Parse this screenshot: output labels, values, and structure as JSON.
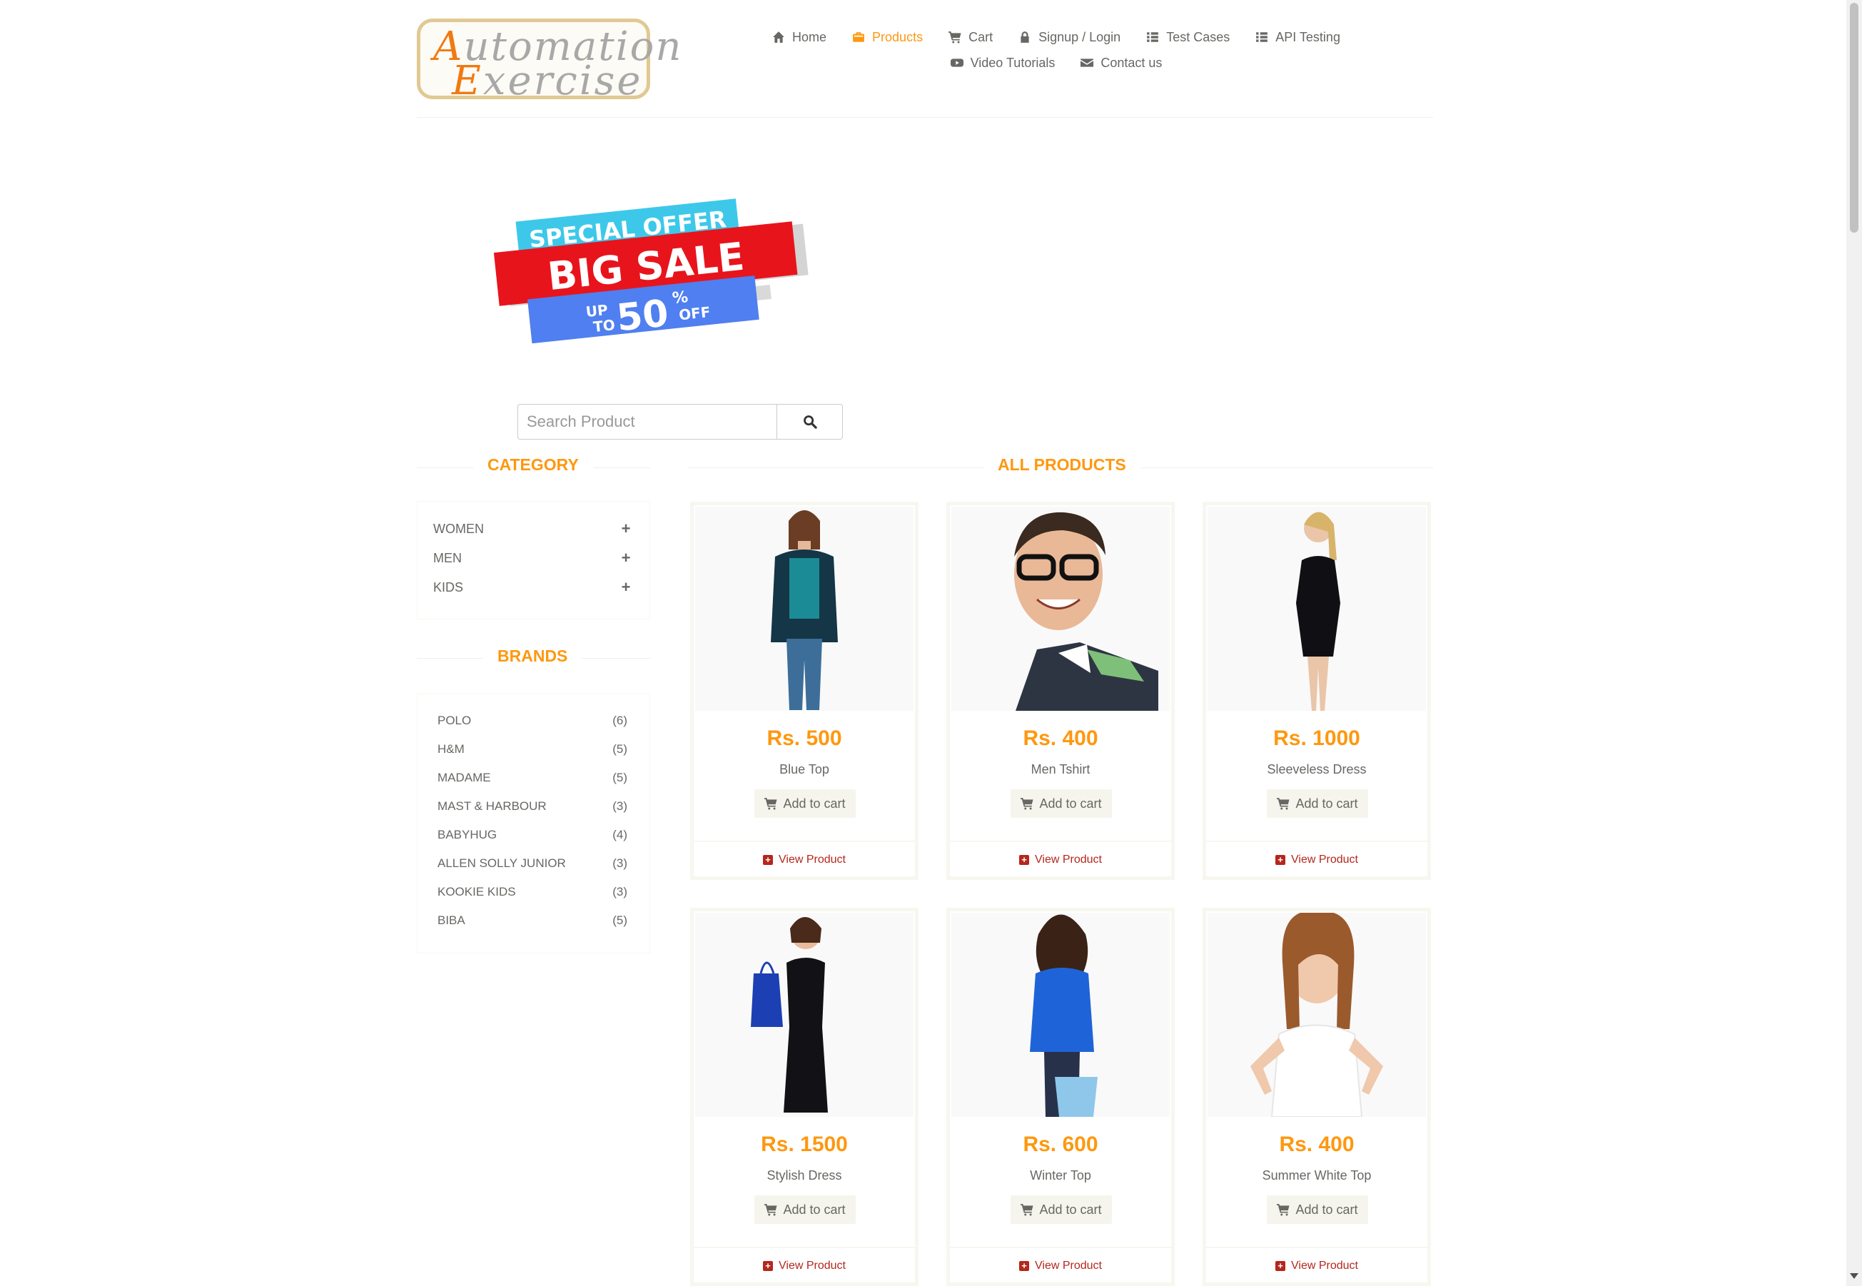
{
  "logo": {
    "line1": "Automation",
    "line2": "Exercise"
  },
  "nav": [
    {
      "label": "Home",
      "icon": "home-icon",
      "active": false
    },
    {
      "label": "Products",
      "icon": "products-icon",
      "active": true
    },
    {
      "label": "Cart",
      "icon": "cart-icon",
      "active": false
    },
    {
      "label": "Signup / Login",
      "icon": "lock-icon",
      "active": false
    },
    {
      "label": "Test Cases",
      "icon": "list-icon",
      "active": false
    },
    {
      "label": "API Testing",
      "icon": "list-icon",
      "active": false
    },
    {
      "label": "Video Tutorials",
      "icon": "youtube-icon",
      "active": false
    },
    {
      "label": "Contact us",
      "icon": "envelope-icon",
      "active": false
    }
  ],
  "banner": {
    "line1": "SPECIAL OFFER",
    "line2": "BIG SALE",
    "up": "UP",
    "to": "TO",
    "amount": "50",
    "percent": "%",
    "off": "OFF"
  },
  "search": {
    "placeholder": "Search Product",
    "value": ""
  },
  "sidebar": {
    "category_title": "Category",
    "categories": [
      "WOMEN",
      "MEN",
      "KIDS"
    ],
    "brands_title": "Brands",
    "brands": [
      {
        "name": "POLO",
        "count": "(6)"
      },
      {
        "name": "H&M",
        "count": "(5)"
      },
      {
        "name": "MADAME",
        "count": "(5)"
      },
      {
        "name": "MAST & HARBOUR",
        "count": "(3)"
      },
      {
        "name": "BABYHUG",
        "count": "(4)"
      },
      {
        "name": "ALLEN SOLLY JUNIOR",
        "count": "(3)"
      },
      {
        "name": "KOOKIE KIDS",
        "count": "(3)"
      },
      {
        "name": "BIBA",
        "count": "(5)"
      }
    ]
  },
  "products_title": "All Products",
  "add_label": "Add to cart",
  "view_label": "View Product",
  "products": [
    {
      "price": "Rs. 500",
      "name": "Blue Top"
    },
    {
      "price": "Rs. 400",
      "name": "Men Tshirt"
    },
    {
      "price": "Rs. 1000",
      "name": "Sleeveless Dress"
    },
    {
      "price": "Rs. 1500",
      "name": "Stylish Dress"
    },
    {
      "price": "Rs. 600",
      "name": "Winter Top"
    },
    {
      "price": "Rs. 400",
      "name": "Summer White Top"
    }
  ],
  "colors": {
    "accent": "#fe980f",
    "text": "#696763",
    "view_link": "#b4271c",
    "border": "#f7f7f0"
  }
}
